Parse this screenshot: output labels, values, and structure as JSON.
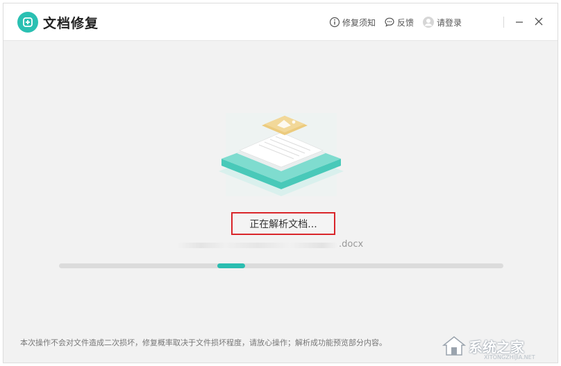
{
  "app": {
    "title": "文档修复"
  },
  "toolbar": {
    "notice_label": "修复须知",
    "feedback_label": "反馈",
    "login_label": "请登录"
  },
  "main": {
    "status_text": "正在解析文档...",
    "file_extension": ".docx",
    "progress_position_fraction": 0.38
  },
  "footer": {
    "note": "本次操作不会对文件造成二次损坏，修复概率取决于文件损坏程度，请放心操作；解析成功能预览部分内容。"
  },
  "watermark": {
    "text": "系统之家",
    "url": "XITONGZHIJIA.NET"
  },
  "colors": {
    "accent": "#2ac0b2",
    "highlight_border": "#d9252a"
  }
}
